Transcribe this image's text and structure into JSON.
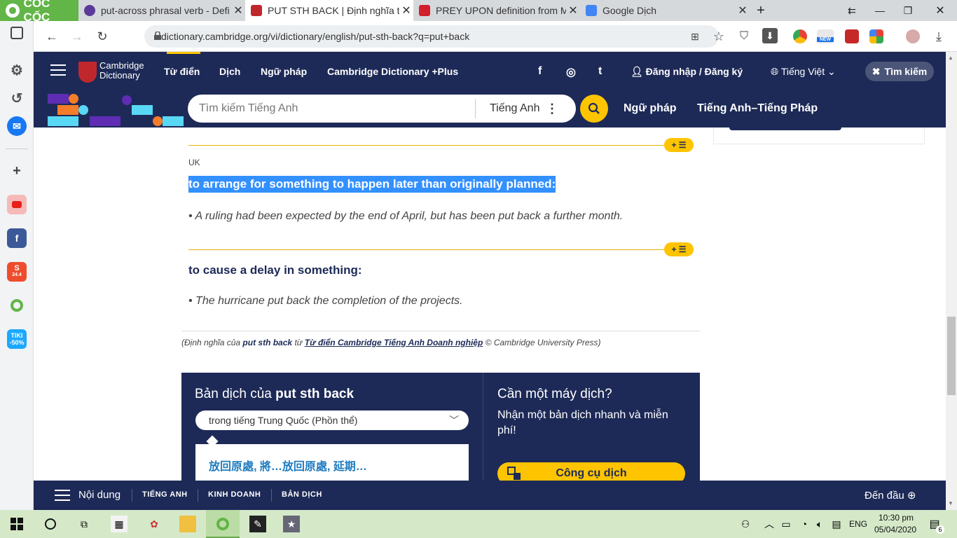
{
  "browser": {
    "brand": "CỐC CỐC",
    "tabs": [
      {
        "title": "put-across phrasal verb - Defi",
        "active": false
      },
      {
        "title": "PUT STH BACK | Định nghĩa tr",
        "active": true
      },
      {
        "title": "PREY UPON definition from M",
        "active": false
      },
      {
        "title": "Google Dịch",
        "active": false
      }
    ],
    "url": "dictionary.cambridge.org/vi/dictionary/english/put-sth-back?q=put+back"
  },
  "site": {
    "logo_line1": "Cambridge",
    "logo_line2": "Dictionary",
    "nav": [
      "Từ điển",
      "Dịch",
      "Ngữ pháp",
      "Cambridge Dictionary +Plus"
    ],
    "social": [
      "f",
      "◎",
      "t"
    ],
    "login": "Đăng nhập / Đăng ký",
    "language": "Tiếng Việt",
    "search_toggle": "Tìm kiếm",
    "search_placeholder": "Tìm kiếm Tiếng Anh",
    "search_lang": "Tiếng Anh",
    "subnav": [
      "Ngữ pháp",
      "Tiếng Anh–Tiếng Pháp"
    ]
  },
  "entry": {
    "region": "UK",
    "senses": [
      {
        "definition": "to arrange for something to happen later than originally planned:",
        "example": "A ruling had been expected by the end of April, but has been put back a further month."
      },
      {
        "definition": "to cause a delay in something:",
        "example": "The hurricane put back the completion of the projects."
      }
    ],
    "credit_prefix": "(Định nghĩa của",
    "credit_word": "put sth back",
    "credit_from": "từ",
    "credit_source": "Từ điển Cambridge Tiếng Anh Doanh nghiệp",
    "credit_suffix": "© Cambridge University Press)"
  },
  "translation": {
    "title_prefix": "Bản dịch của",
    "title_word": "put sth back",
    "language_option": "trong tiếng Trung Quốc (Phồn thể)",
    "result": "放回原處, 將…放回原處, 延期…",
    "mt_title": "Cần một máy dịch?",
    "mt_text": "Nhận một bản dịch nhanh và miễn phí!",
    "mt_button": "Công cụ dịch"
  },
  "bottom_bar": {
    "contents": "Nội dung",
    "links": [
      "TIẾNG ANH",
      "KINH DOANH",
      "BẢN DỊCH"
    ],
    "to_top": "Đến đầu"
  },
  "taskbar": {
    "lang": "ENG",
    "time": "10:30 pm",
    "date": "05/04/2020",
    "notifications": "6"
  },
  "sidebar": {
    "shopee_badge": "24.4",
    "tiki_line1": "TIKI",
    "tiki_line2": "-50%"
  },
  "colors": {
    "cambridge_navy": "#1d2a57",
    "accent_yellow": "#fec400",
    "selection_blue": "#3390ff",
    "coccoc_green": "#62b547"
  }
}
